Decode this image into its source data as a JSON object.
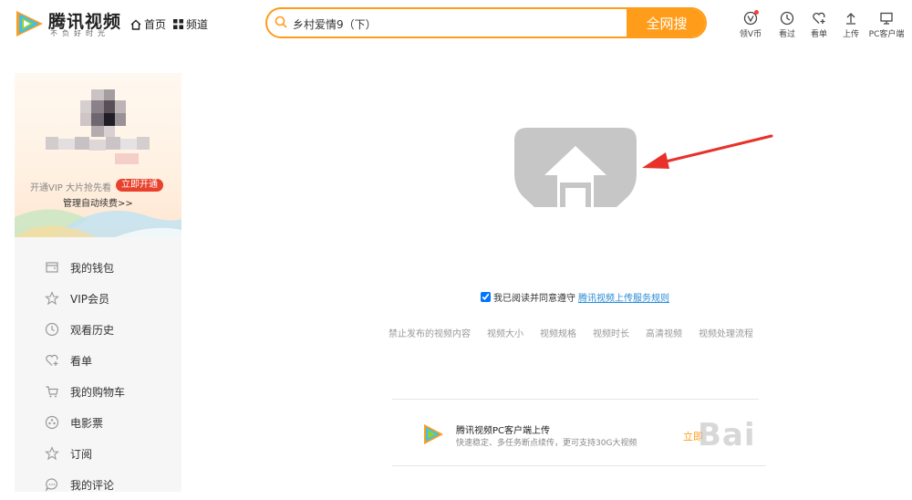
{
  "header": {
    "logo_text": "腾讯视频",
    "logo_slogan": "不负好时光",
    "nav": {
      "home": "首页",
      "channel": "频道"
    },
    "search": {
      "value": "乡村爱情9（下）",
      "button": "全网搜"
    },
    "tools": [
      {
        "label": "领V币",
        "icon": "vcoin-icon"
      },
      {
        "label": "看过",
        "icon": "clock-icon"
      },
      {
        "label": "看单",
        "icon": "heart-plus-icon"
      },
      {
        "label": "上传",
        "icon": "upload-icon"
      },
      {
        "label": "PC客户端",
        "icon": "monitor-icon"
      }
    ]
  },
  "sidebar": {
    "vip_text": "开通VIP 大片抢先看",
    "vip_button": "立即开通",
    "renew_link": "管理自动续费>>",
    "menu": [
      {
        "label": "我的钱包",
        "icon": "wallet-icon"
      },
      {
        "label": "VIP会员",
        "icon": "star-vip-icon"
      },
      {
        "label": "观看历史",
        "icon": "history-icon"
      },
      {
        "label": "看单",
        "icon": "heart-plus-icon"
      },
      {
        "label": "我的购物车",
        "icon": "cart-icon"
      },
      {
        "label": "电影票",
        "icon": "ticket-icon"
      },
      {
        "label": "订阅",
        "icon": "star-icon"
      },
      {
        "label": "我的评论",
        "icon": "comment-icon"
      }
    ]
  },
  "main": {
    "agree_text": "我已阅读并同意遵守",
    "agree_link": "腾讯视频上传服务规则",
    "rules": [
      "禁止发布的视频内容",
      "视频大小",
      "视频规格",
      "视频时长",
      "高清视频",
      "视频处理流程"
    ],
    "pc_client": {
      "title": "腾讯视频PC客户端上传",
      "desc": "快速稳定、多任务断点续传，更可支持30G大视频",
      "button": "立即"
    },
    "watermark": "Bai"
  },
  "colors": {
    "accent": "#ff9c1a",
    "vip_red": "#e8412c",
    "link_blue": "#2a8cd6",
    "upload_gray": "#c6c6c6",
    "arrow_red": "#e8312a"
  }
}
